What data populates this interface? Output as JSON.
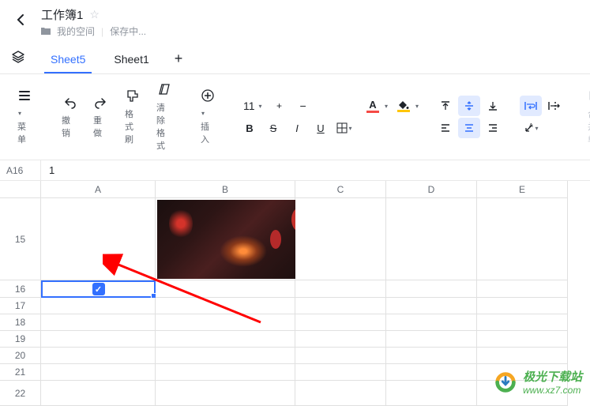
{
  "header": {
    "doc_title": "工作簿1",
    "space_label": "我的空间",
    "save_status": "保存中..."
  },
  "tabs": {
    "active": "Sheet5",
    "items": [
      "Sheet5",
      "Sheet1"
    ]
  },
  "toolbar": {
    "menu": "菜单",
    "undo": "撤销",
    "redo": "重做",
    "format_painter": "格式刷",
    "clear_format": "清除格式",
    "insert": "插入",
    "font_size": "11",
    "merge": "合并单"
  },
  "formula_bar": {
    "cell_ref": "A16",
    "value": "1"
  },
  "grid": {
    "columns": [
      "A",
      "B",
      "C",
      "D",
      "E"
    ],
    "rows": [
      "15",
      "16",
      "17",
      "18",
      "19",
      "20",
      "21",
      "22"
    ],
    "selected_cell": "A16",
    "checkbox_checked": true
  },
  "watermark": {
    "title": "极光下载站",
    "url": "www.xz7.com"
  },
  "icons": {
    "back": "‹",
    "star": "☆",
    "folder": "■",
    "layers": "❖",
    "plus": "+",
    "undo": "↶",
    "redo": "↷",
    "brush": "⟡",
    "eraser": "◇",
    "insert_plus": "⊕",
    "minus": "−",
    "bold": "B",
    "strikethrough": "S",
    "italic": "I",
    "underline": "U",
    "border": "⊞",
    "valign_top": "⫠",
    "valign_mid": "⫲",
    "valign_bot": "⫨",
    "align_left": "≡",
    "align_center": "≡",
    "align_right": "≡",
    "wrap": "⟐",
    "rotate": "⤹",
    "merge_icon": "⊟",
    "check": "✓",
    "menu_icon": "⊜"
  }
}
